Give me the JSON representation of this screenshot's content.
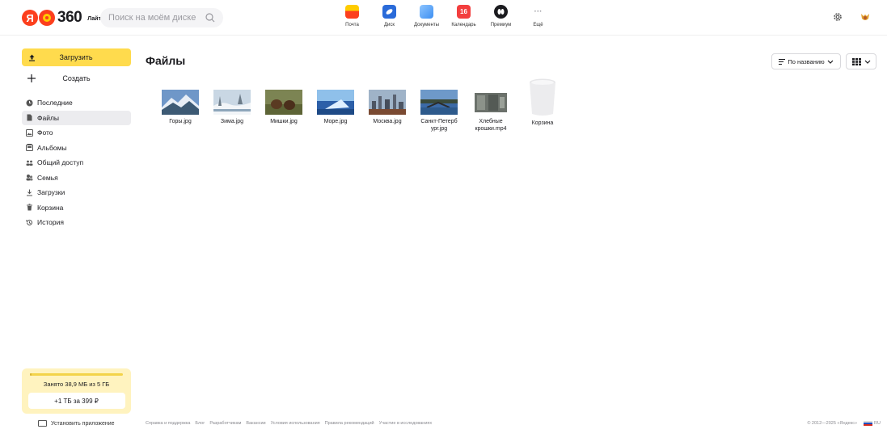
{
  "header": {
    "logo_letter": "Я",
    "logo_number": "360",
    "logo_badge": "Лайт",
    "search_placeholder": "Поиск на моём диске",
    "services": [
      {
        "label": "Почта",
        "icon": "mail-icon",
        "color": "#ffcc00"
      },
      {
        "label": "Диск",
        "icon": "disk-icon",
        "color": "#2a6bd9"
      },
      {
        "label": "Документы",
        "icon": "documents-icon",
        "color": "#3d8ff2"
      },
      {
        "label": "Календарь",
        "icon": "calendar-icon",
        "color": "#f33e3e",
        "badge": "16"
      },
      {
        "label": "Премиум",
        "icon": "premium-icon",
        "color": "#1b1b1f"
      },
      {
        "label": "Ещё",
        "icon": "more-icon",
        "color": "#9a9aa0"
      }
    ]
  },
  "sidebar": {
    "upload_label": "Загрузить",
    "create_label": "Создать",
    "items": [
      {
        "label": "Последние",
        "icon": "clock-icon"
      },
      {
        "label": "Файлы",
        "icon": "file-icon",
        "active": true
      },
      {
        "label": "Фото",
        "icon": "photo-icon"
      },
      {
        "label": "Альбомы",
        "icon": "album-icon"
      },
      {
        "label": "Общий доступ",
        "icon": "shared-icon"
      },
      {
        "label": "Семья",
        "icon": "family-icon"
      },
      {
        "label": "Загрузки",
        "icon": "download-icon"
      },
      {
        "label": "Корзина",
        "icon": "trash-icon"
      },
      {
        "label": "История",
        "icon": "history-icon"
      }
    ],
    "storage": {
      "used_text": "Занято 38,9 МБ из 5 ГБ",
      "used_fraction": 0.0076,
      "upgrade_label": "+1 ТБ за 399 ₽"
    },
    "install_label": "Установить приложение"
  },
  "main": {
    "title": "Файлы",
    "sort_label": "По названию",
    "files": [
      {
        "name": "Горы.jpg",
        "kind": "mountains"
      },
      {
        "name": "Зима.jpg",
        "kind": "winter"
      },
      {
        "name": "Мишки.jpg",
        "kind": "bears"
      },
      {
        "name": "Море.jpg",
        "kind": "sea"
      },
      {
        "name": "Москва.jpg",
        "kind": "moscow"
      },
      {
        "name": "Санкт-Петерб\nург.jpg",
        "kind": "spb"
      },
      {
        "name": "Хлебные\nкрошки.mp4",
        "kind": "video"
      },
      {
        "name": "Корзина",
        "kind": "trash"
      }
    ]
  },
  "footer": {
    "links": [
      "Справка и поддержка",
      "Блог",
      "Разработчикам",
      "Вакансии",
      "Условия использования",
      "Правила рекомендаций",
      "Участие в исследованиях"
    ],
    "copyright": "© 2012—2025 «Яндекс»",
    "lang": "RU"
  },
  "colors": {
    "accent_yellow": "#ffdb4d",
    "active_item_bg": "#ececef",
    "storage_bg": "#fff3bf"
  }
}
